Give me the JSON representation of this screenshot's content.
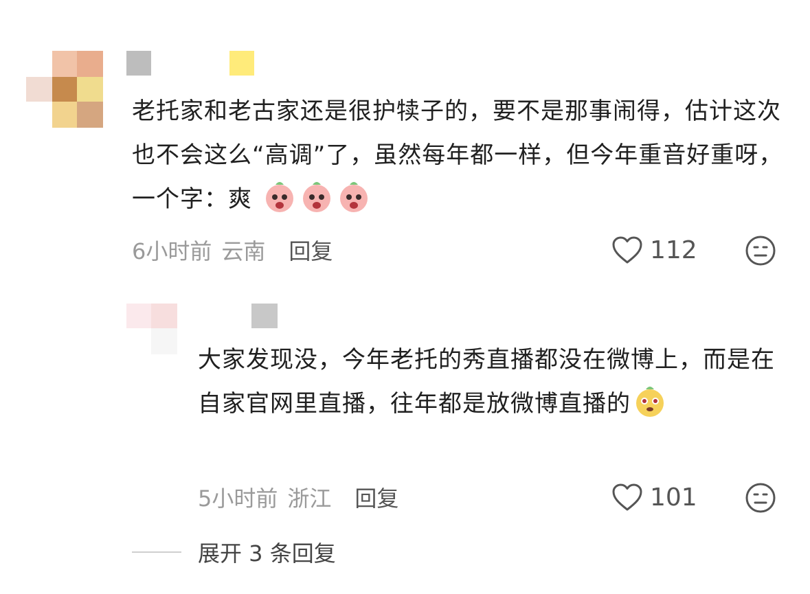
{
  "comments": [
    {
      "text": "老托家和老古家还是很护犊子的，要不是那事闹得，估计这次也不会这么“高调”了，虽然每年都一样，但今年重音好重呀，一个字：爽",
      "time": "6小时前",
      "location": "云南",
      "reply_label": "回复",
      "likes": "112",
      "emoji_count": 3
    }
  ],
  "replies": [
    {
      "text": "大家发现没，今年老托的秀直播都没在微博上，而是在自家官网里直播，往年都是放微博直播的",
      "time": "5小时前",
      "location": "浙江",
      "reply_label": "回复",
      "likes": "101"
    }
  ],
  "expand_replies_label": "展开 3 条回复",
  "colors": {
    "text": "#202020",
    "meta": "#9a9a9a",
    "reply": "#555555",
    "avatar1": [
      "#f1c3a8",
      "#e9ad8d",
      "#d7a172",
      "#c68a4d",
      "#f2d38e",
      "#f0dc8e",
      "#d5a680"
    ],
    "avatar2": [
      "#fde9ec",
      "#f7dede",
      "#f2f2f2"
    ]
  },
  "icons": {
    "like": "heart-outline-icon",
    "dislike": "neutral-face-icon",
    "emoji1": "shouting-peach-emoji",
    "emoji2": "excited-peach-emoji"
  }
}
